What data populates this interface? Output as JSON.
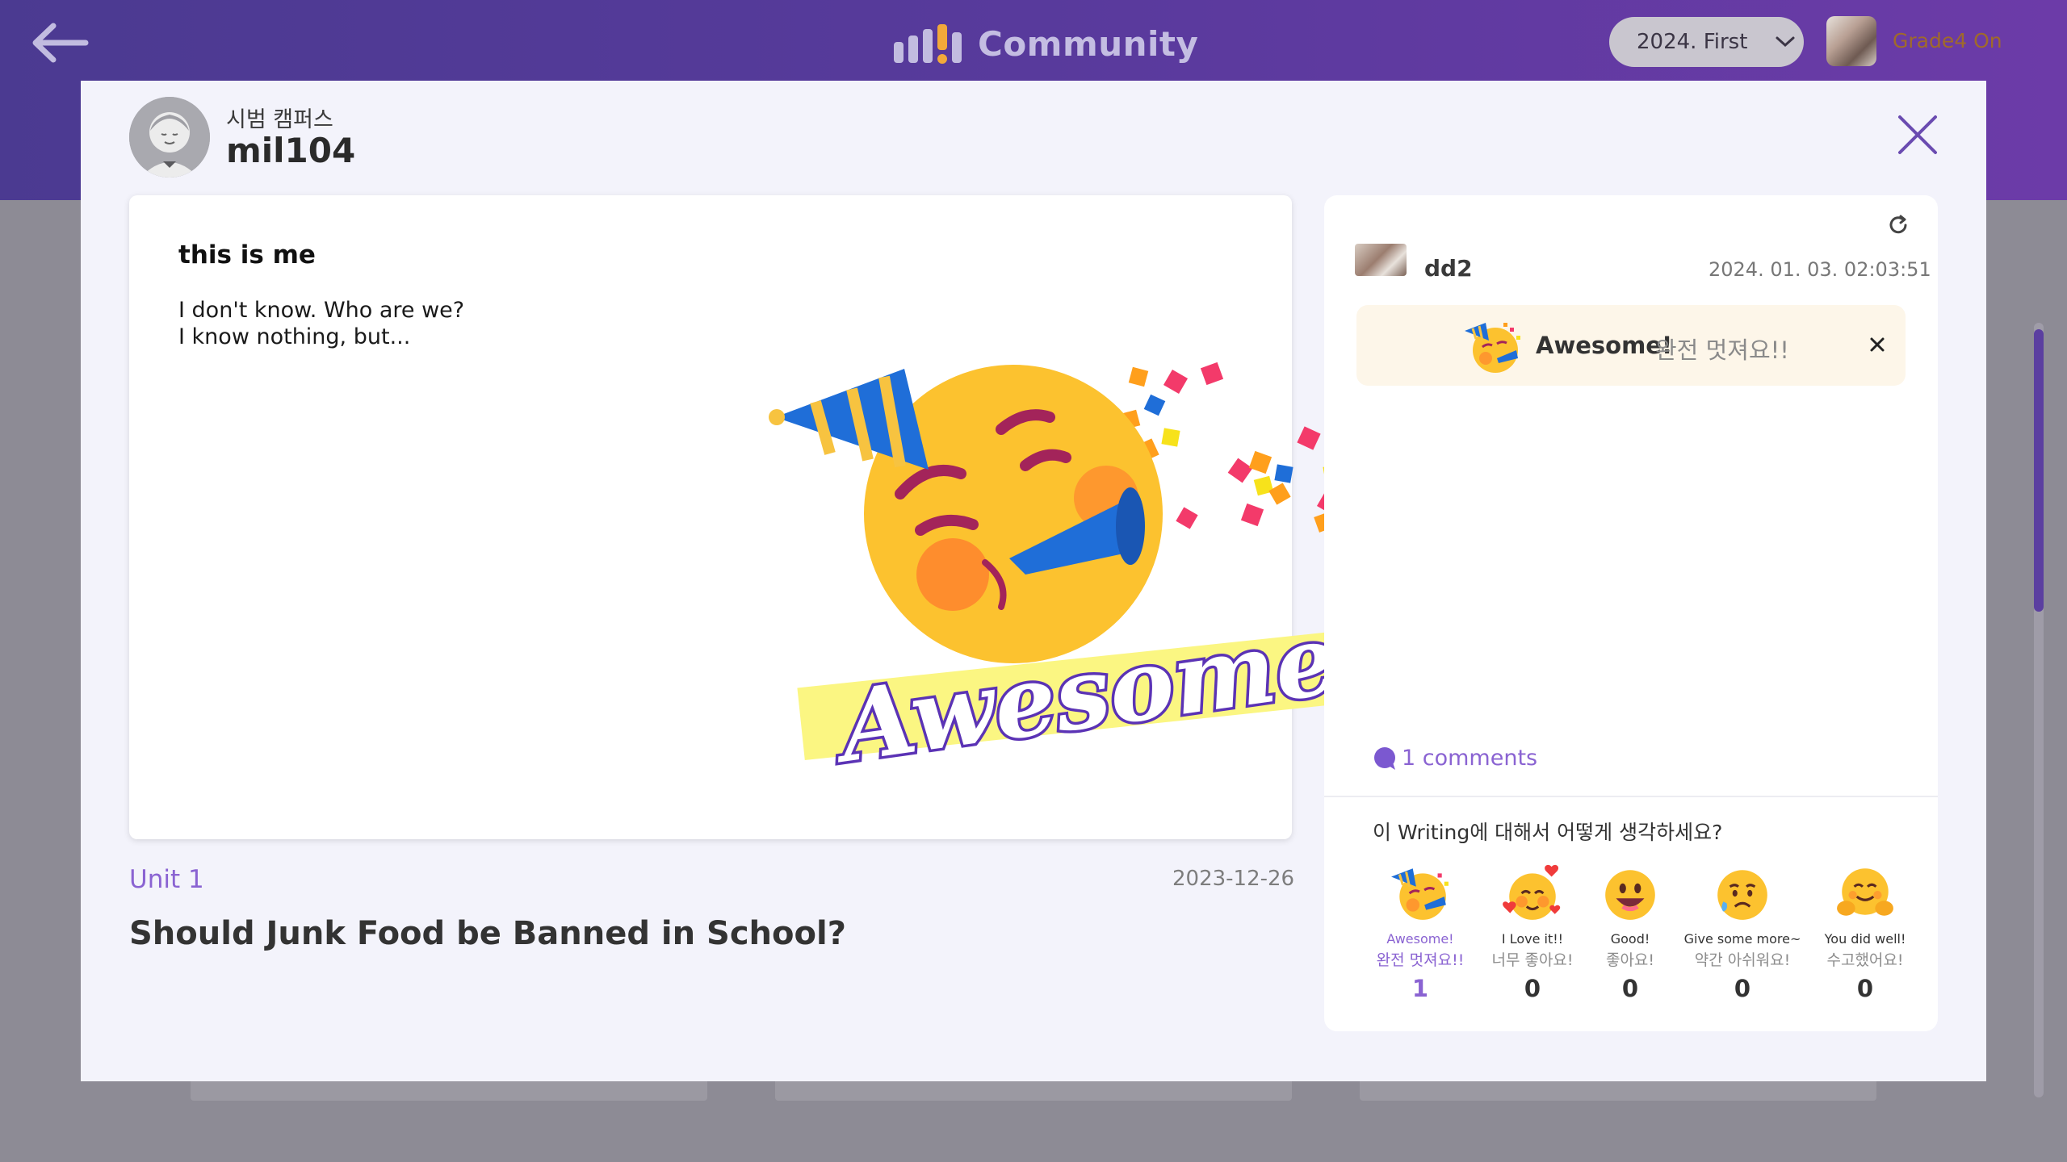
{
  "header": {
    "title": "Community",
    "semester": "2024. First",
    "user_grade": "Grade4 On"
  },
  "post": {
    "campus": "시범 캠퍼스",
    "author": "mil104",
    "title": "this is me",
    "body_line1": "I don't know. Who are we?",
    "body_line2": "I know nothing, but...",
    "sticker_text": "Awesome!",
    "unit": "Unit 1",
    "date": "2023-12-26",
    "topic": "Should Junk Food be Banned in School?"
  },
  "comment": {
    "user": "dd2",
    "timestamp": "2024. 01. 03. 02:03:51",
    "reaction_en": "Awesome!",
    "reaction_ko": "완전 멋져요!!"
  },
  "comments_link": "1 comments",
  "question": "이 Writing에 대해서 어떻게 생각하세요?",
  "reactions": [
    {
      "en": "Awesome!",
      "ko": "완전 멋져요!!",
      "count": "1",
      "icon": "party-face-icon"
    },
    {
      "en": "I Love it!!",
      "ko": "너무 좋아요!",
      "count": "0",
      "icon": "hearts-face-icon"
    },
    {
      "en": "Good!",
      "ko": "좋아요!",
      "count": "0",
      "icon": "grin-face-icon"
    },
    {
      "en": "Give some more~",
      "ko": "약간 아쉬워요!",
      "count": "0",
      "icon": "sad-face-icon"
    },
    {
      "en": "You did well!",
      "ko": "수고했어요!",
      "count": "0",
      "icon": "hug-face-icon"
    }
  ],
  "colors": {
    "accent": "#8a63d2",
    "header_start": "#4b3a91",
    "header_end": "#6c3ba8"
  }
}
